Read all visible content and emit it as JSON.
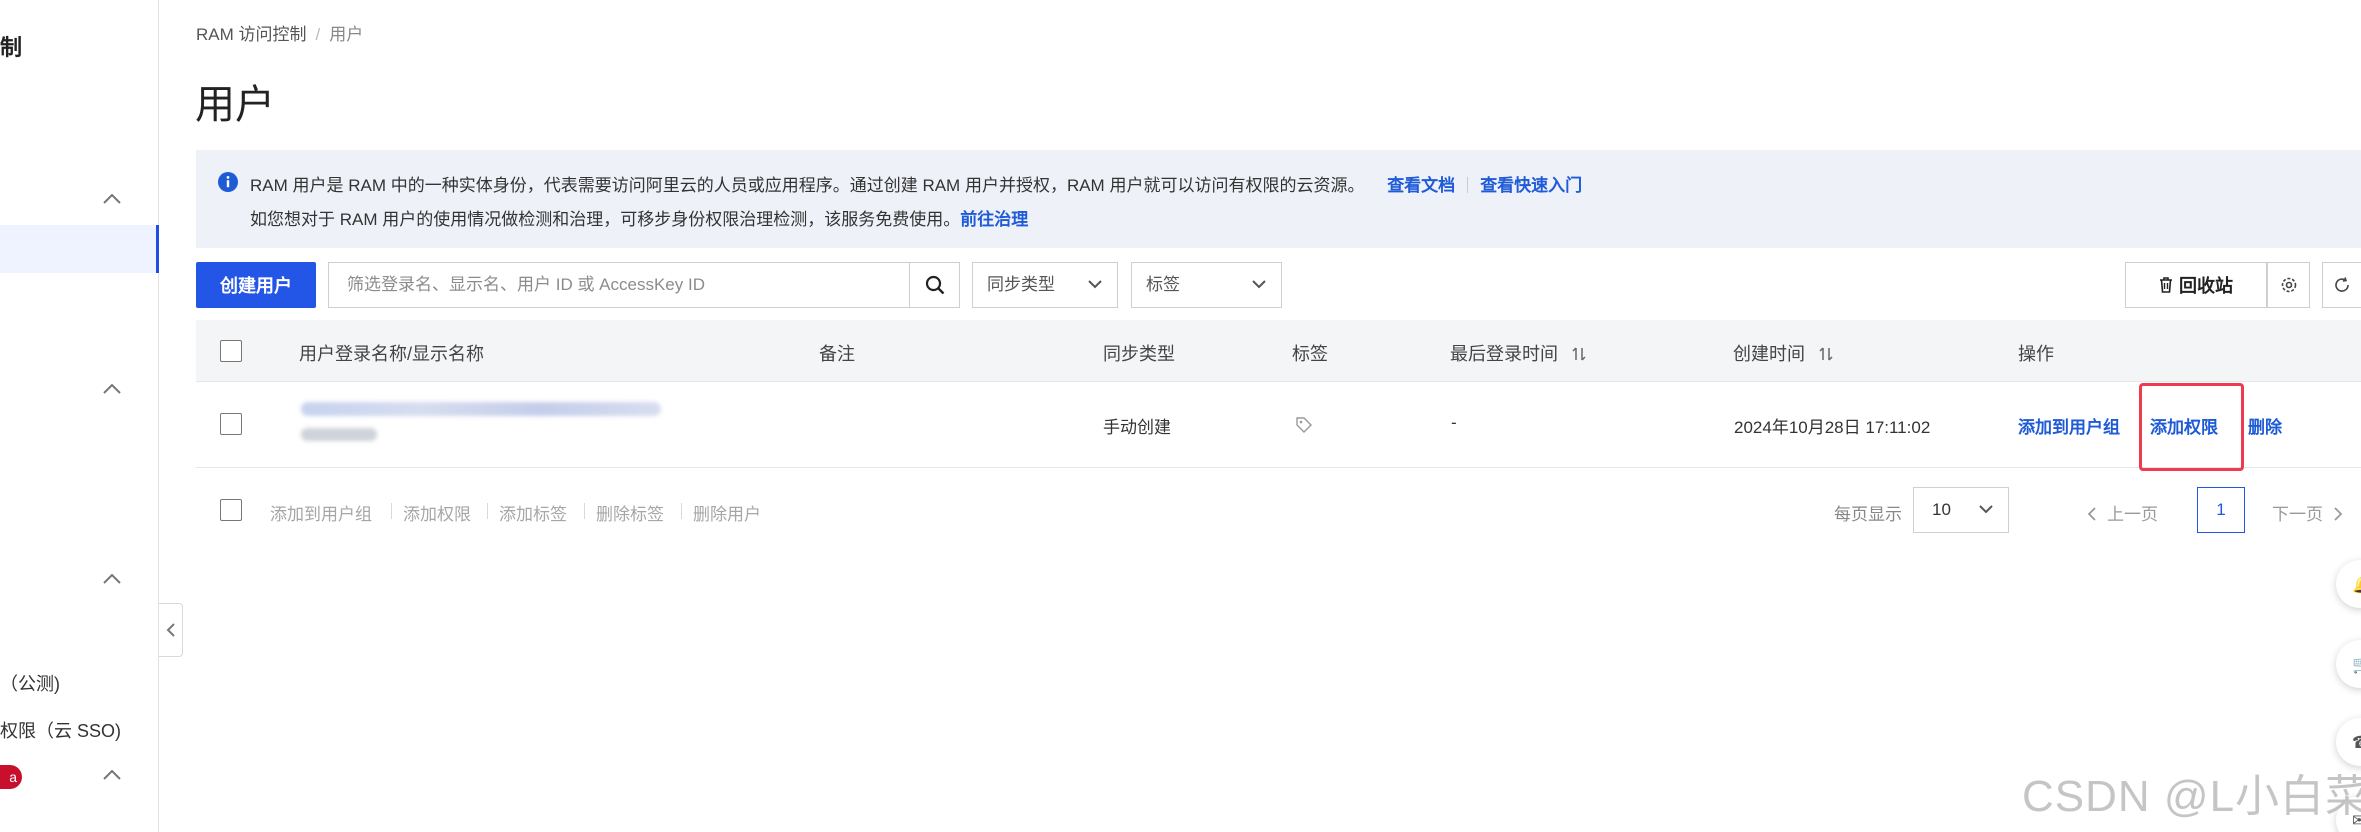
{
  "sidebar": {
    "title": "制",
    "items": [
      {
        "label": "（公测)"
      },
      {
        "label": "权限（云 SSO)"
      },
      {
        "label": "a"
      }
    ]
  },
  "breadcrumb": {
    "root": "RAM 访问控制",
    "sep": "/",
    "current": "用户"
  },
  "page_title": "用户",
  "notice": {
    "text1": "RAM 用户是 RAM 中的一种实体身份，代表需要访问阿里云的人员或应用程序。通过创建 RAM 用户并授权，RAM 用户就可以访问有权限的云资源。",
    "link_docs": "查看文档",
    "link_quickstart": "查看快速入门",
    "text2": "如您想对于 RAM 用户的使用情况做检测和治理，可移步身份权限治理检测，该服务免费使用。",
    "link_govern": "前往治理"
  },
  "toolbar": {
    "create_user": "创建用户",
    "search_placeholder": "筛选登录名、显示名、用户 ID 或 AccessKey ID",
    "sync_type": "同步类型",
    "tags": "标签",
    "recycle_bin": "回收站"
  },
  "table": {
    "columns": [
      "用户登录名称/显示名称",
      "备注",
      "同步类型",
      "标签",
      "最后登录时间",
      "创建时间",
      "操作"
    ],
    "rows": [
      {
        "remark": "",
        "sync_type": "手动创建",
        "last_login": "-",
        "created": "2024年10月28日 17:11:02",
        "actions": [
          "添加到用户组",
          "添加权限",
          "删除"
        ]
      }
    ]
  },
  "bulk_actions": [
    "添加到用户组",
    "添加权限",
    "添加标签",
    "删除标签",
    "删除用户"
  ],
  "pagination": {
    "per_page_label": "每页显示",
    "per_page": "10",
    "prev": "上一页",
    "current": "1",
    "next": "下一页"
  },
  "watermark": "CSDN @L小白菜",
  "colors": {
    "primary": "#2356e6",
    "link": "#1f5bd7",
    "highlight": "#ee3b4f"
  }
}
